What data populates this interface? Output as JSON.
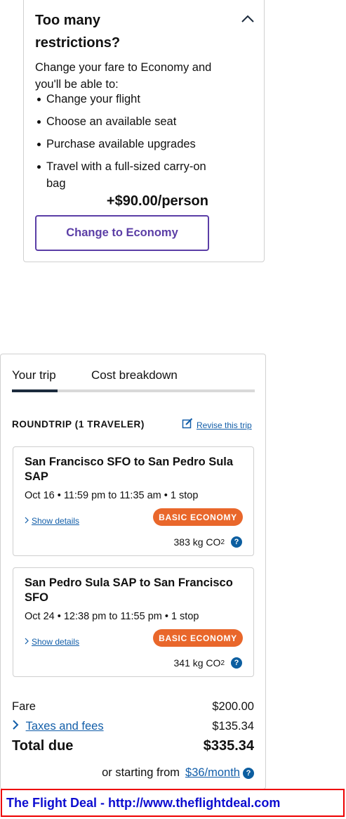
{
  "upsell": {
    "title": "Too many restrictions?",
    "description": "Change your fare to Economy and you'll be able to:",
    "benefits": [
      "Change your flight",
      "Choose an available seat",
      "Purchase available upgrades",
      "Travel with a full-sized carry-on bag"
    ],
    "price": "+$90.00/person",
    "button_label": "Change to Economy"
  },
  "summary": {
    "tabs": [
      "Your trip",
      "Cost breakdown"
    ],
    "active_tab": "Your trip",
    "trip_label": "ROUNDTRIP (1 TRAVELER)",
    "revise_label": "Revise this trip",
    "segments": [
      {
        "title": "San Francisco SFO to San Pedro Sula SAP",
        "time": "Oct 16 • 11:59 pm to 11:35 am • 1 stop",
        "details_label": "Show details",
        "fare_class": "BASIC ECONOMY",
        "co2": "383 kg CO",
        "co2_sub": "2"
      },
      {
        "title": "San Pedro Sula SAP to San Francisco SFO",
        "time": "Oct 24 • 12:38 pm to 11:55 pm • 1 stop",
        "details_label": "Show details",
        "fare_class": "BASIC ECONOMY",
        "co2": "341 kg CO",
        "co2_sub": "2"
      }
    ],
    "fare_label": "Fare",
    "fare_value": "$200.00",
    "taxes_label": "Taxes and fees",
    "taxes_value": "$135.34",
    "total_label": "Total due",
    "total_value": "$335.34",
    "monthly_prefix": "or starting from",
    "monthly_link": "$36/month"
  },
  "banner": {
    "text": "The Flight Deal - http://www.theflightdeal.com"
  },
  "icons": {
    "collapse": "chevron-up-icon",
    "edit": "edit-icon",
    "expand": "chevron-right-icon",
    "help": "question-icon"
  },
  "colors": {
    "accent": "#5b3ea6",
    "link": "#125ea9",
    "badge": "#e9672b",
    "banner_border": "#ee0000",
    "banner_text": "#0d0dd0"
  }
}
